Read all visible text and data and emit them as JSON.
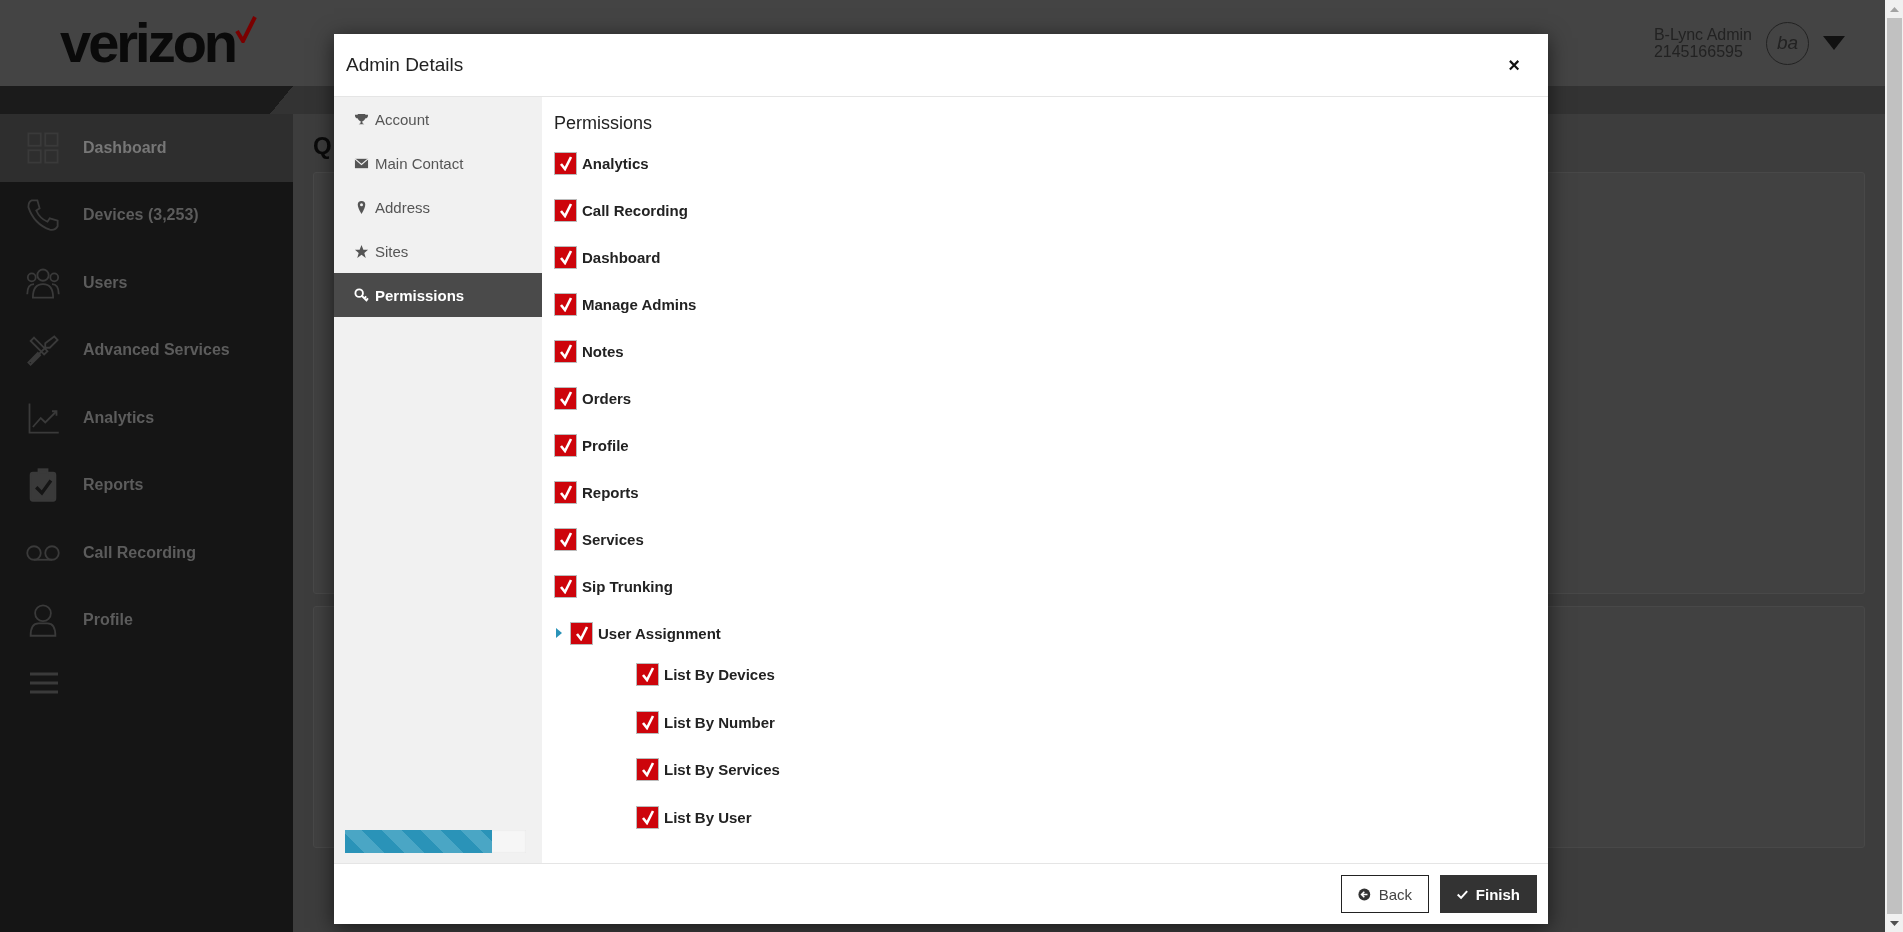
{
  "header": {
    "logo": "verizon",
    "user_name": "B-Lync Admin",
    "user_phone": "2145166595",
    "avatar_initials": "ba"
  },
  "sidebar": {
    "items": [
      {
        "label": "Dashboard",
        "selected": true
      },
      {
        "label": "Devices (3,253)",
        "selected": false
      },
      {
        "label": "Users",
        "selected": false
      },
      {
        "label": "Advanced Services",
        "selected": false
      },
      {
        "label": "Analytics",
        "selected": false
      },
      {
        "label": "Reports",
        "selected": false
      },
      {
        "label": "Call Recording",
        "selected": false
      },
      {
        "label": "Profile",
        "selected": false
      }
    ]
  },
  "page": {
    "title": "Q"
  },
  "modal": {
    "title": "Admin Details",
    "close": "×",
    "nav": [
      {
        "label": "Account",
        "selected": false
      },
      {
        "label": "Main Contact",
        "selected": false
      },
      {
        "label": "Address",
        "selected": false
      },
      {
        "label": "Sites",
        "selected": false
      },
      {
        "label": "Permissions",
        "selected": true
      }
    ],
    "progress": {
      "level": 0.81
    },
    "section_title": "Permissions",
    "permissions": [
      {
        "label": "Analytics",
        "checked": true
      },
      {
        "label": "Call Recording",
        "checked": true
      },
      {
        "label": "Dashboard",
        "checked": true
      },
      {
        "label": "Manage Admins",
        "checked": true
      },
      {
        "label": "Notes",
        "checked": true
      },
      {
        "label": "Orders",
        "checked": true
      },
      {
        "label": "Profile",
        "checked": true
      },
      {
        "label": "Reports",
        "checked": true
      },
      {
        "label": "Services",
        "checked": true
      },
      {
        "label": "Sip Trunking",
        "checked": true
      },
      {
        "label": "User Assignment",
        "checked": true,
        "children": [
          {
            "label": "List By Devices",
            "checked": true
          },
          {
            "label": "List By Number",
            "checked": true
          },
          {
            "label": "List By Services",
            "checked": true
          },
          {
            "label": "List By User",
            "checked": true
          }
        ]
      }
    ],
    "buttons": [
      {
        "label": "Back",
        "kind": "back"
      },
      {
        "label": "Finish",
        "kind": "finish"
      }
    ]
  }
}
